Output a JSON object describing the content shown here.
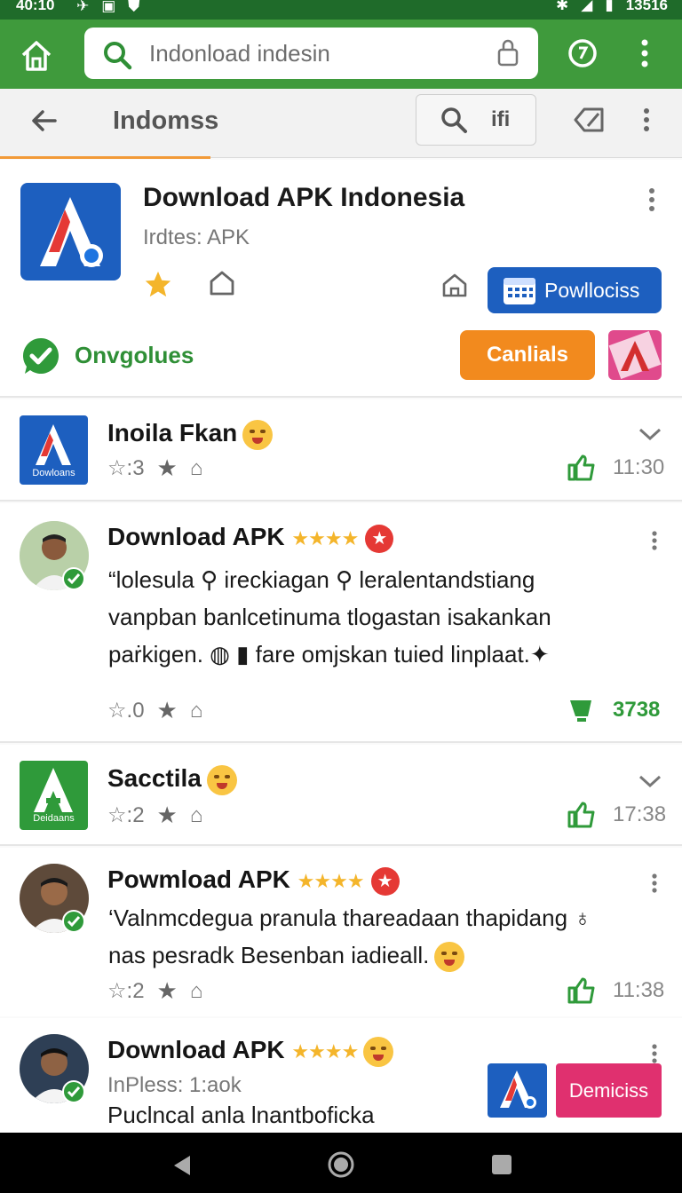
{
  "status_bar": {
    "time": "40:10",
    "right_time": "13516"
  },
  "browser": {
    "url_text": "Indonload indesin",
    "tab_title": "Indomss",
    "search_label": "ifi"
  },
  "app": {
    "title": "Download APK Indonesia",
    "subtitle": "Irdtes: APK",
    "primary_button": "Powllociss",
    "verified_label": "Onvgolues",
    "cancel_button": "Canlials"
  },
  "feed": [
    {
      "type": "app",
      "name": "Inoila Fkan",
      "rating": "3",
      "time": "11:30",
      "tile_caption": "Dowloans",
      "tile_color": "#1d5fbf"
    },
    {
      "type": "review",
      "name": "Download APK",
      "stars": "★★★★",
      "lines": [
        "“lolesula ⚲ ireckiagan ⚲ leralentandstiang",
        "vanpban banlcetinuma tlogastan isakankan",
        "paṙkigen. ◍ ▮ fare omjskan tuied linplaat.✦"
      ],
      "rating": "0",
      "count": "3738"
    },
    {
      "type": "app",
      "name": "Sacctila",
      "rating": "2",
      "time": "17:38",
      "tile_caption": "Deidaans",
      "tile_color": "#2f9a3a"
    },
    {
      "type": "review",
      "name": "Powmload APK",
      "stars": "★★★★",
      "lines": [
        "‘Valnmcdegua pranula thareadaan thapidang ♁",
        "nas pesradk Besenban iadieall."
      ],
      "rating": "2",
      "time": "11:38"
    },
    {
      "type": "review",
      "name": "Download APK",
      "stars": "★★★★",
      "subline": "InPless: 1:aok",
      "line": "Puclncal anla lnantboficka",
      "button": "Demiciss"
    }
  ],
  "colors": {
    "brand_green": "#3f9a3c",
    "brand_blue": "#1d5fbf",
    "accent_orange": "#f28a1e",
    "promo_pink": "#e04a8c"
  }
}
